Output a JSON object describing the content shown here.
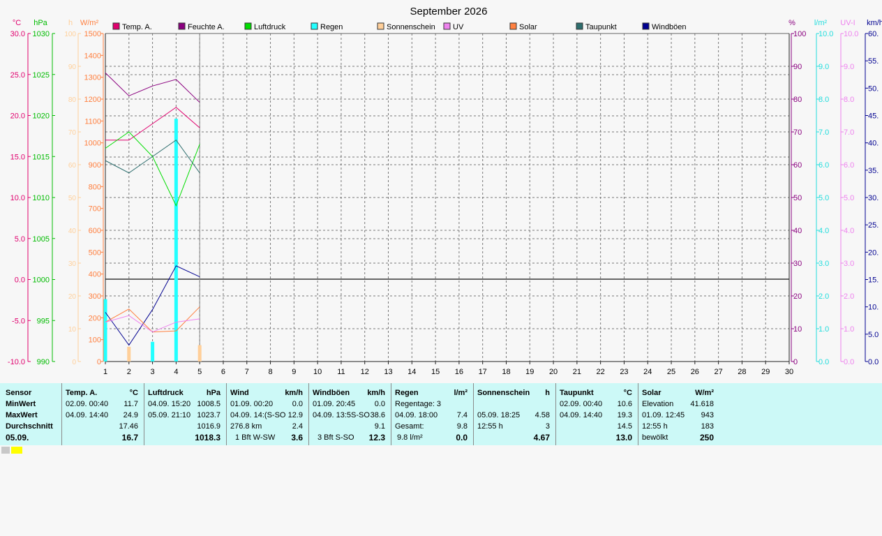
{
  "title": "September 2026",
  "legend": [
    {
      "label": "Temp. A.",
      "color": "#e0006e"
    },
    {
      "label": "Feuchte A.",
      "color": "#8a007f"
    },
    {
      "label": "Luftdruck",
      "color": "#00dd00"
    },
    {
      "label": "Regen",
      "color": "#22ffff"
    },
    {
      "label": "Sonnenschein",
      "color": "#ffcf99"
    },
    {
      "label": "UV",
      "color": "#ee82ee"
    },
    {
      "label": "Solar",
      "color": "#ff8040"
    },
    {
      "label": "Taupunkt",
      "color": "#2e6e6e"
    },
    {
      "label": "Windböen",
      "color": "#000090"
    }
  ],
  "axes": {
    "temp": {
      "unit": "°C",
      "color": "#e0006e",
      "ticks": [
        "30.0",
        "25.0",
        "20.0",
        "15.0",
        "10.0",
        "5.0",
        "0.0",
        "-5.0",
        "-10.0"
      ]
    },
    "pressure": {
      "unit": "hPa",
      "color": "#00bb00",
      "ticks": [
        "1030",
        "1025",
        "1020",
        "1015",
        "1010",
        "1005",
        "1000",
        "995",
        "990"
      ]
    },
    "sunshine": {
      "unit": "h",
      "color": "#ffcf99",
      "ticks": [
        "100",
        "90",
        "80",
        "70",
        "60",
        "50",
        "40",
        "30",
        "20",
        "10",
        "0"
      ]
    },
    "solar": {
      "unit": "W/m²",
      "color": "#ff8040",
      "ticks": [
        "1500",
        "1400",
        "1300",
        "1200",
        "1100",
        "1000",
        "900",
        "800",
        "700",
        "600",
        "500",
        "400",
        "300",
        "200",
        "100",
        "0"
      ]
    },
    "humidity": {
      "unit": "%",
      "color": "#8a007f",
      "ticks": [
        "100",
        "90",
        "80",
        "70",
        "60",
        "50",
        "40",
        "30",
        "20",
        "10",
        "0"
      ]
    },
    "rain": {
      "unit": "l/m²",
      "color": "#22dddd",
      "ticks": [
        "10.0",
        "9.0",
        "8.0",
        "7.0",
        "6.0",
        "5.0",
        "4.0",
        "3.0",
        "2.0",
        "1.0",
        "0.0"
      ]
    },
    "uv": {
      "unit": "UV-I",
      "color": "#ee82ee",
      "ticks": [
        "10.0",
        "9.0",
        "8.0",
        "7.0",
        "6.0",
        "5.0",
        "4.0",
        "3.0",
        "2.0",
        "1.0",
        "0.0"
      ]
    },
    "wind": {
      "unit": "km/h",
      "color": "#000090",
      "ticks": [
        "60.",
        "55.",
        "50.",
        "45.",
        "40.",
        "35.",
        "30.",
        "25.",
        "20.",
        "15.",
        "10.",
        "5.0",
        "0.0"
      ]
    },
    "x_ticks": [
      "1",
      "2",
      "3",
      "4",
      "5",
      "6",
      "7",
      "8",
      "9",
      "10",
      "11",
      "12",
      "13",
      "14",
      "15",
      "16",
      "17",
      "18",
      "19",
      "20",
      "21",
      "22",
      "23",
      "24",
      "25",
      "26",
      "27",
      "28",
      "29",
      "30"
    ]
  },
  "chart_data": {
    "type": "line",
    "title": "September 2026",
    "x": [
      1,
      2,
      3,
      4,
      5
    ],
    "xlim": [
      1,
      30
    ],
    "grid": true,
    "series": [
      {
        "name": "Temp. A.",
        "axis": "temp",
        "values": [
          17.0,
          17.0,
          19.0,
          21.0,
          18.5
        ]
      },
      {
        "name": "Feuchte A.",
        "axis": "humidity",
        "values": [
          88,
          81,
          84,
          86,
          79
        ]
      },
      {
        "name": "Luftdruck",
        "axis": "pressure",
        "values": [
          1016.0,
          1018.0,
          1015.0,
          1009.0,
          1016.5
        ]
      },
      {
        "name": "Taupunkt",
        "axis": "temp",
        "values": [
          14.5,
          13.0,
          15.0,
          17.0,
          13.0
        ]
      },
      {
        "name": "Windböen",
        "axis": "wind",
        "values": [
          9.0,
          3.0,
          9.5,
          17.5,
          15.5
        ]
      },
      {
        "name": "Solar",
        "axis": "solar",
        "values": [
          180,
          240,
          135,
          140,
          250
        ]
      },
      {
        "name": "UV",
        "axis": "uv",
        "values": [
          1.2,
          1.4,
          0.9,
          1.2,
          1.3
        ]
      }
    ],
    "bars": [
      {
        "name": "Regen",
        "axis": "rain",
        "values": [
          1.9,
          0.0,
          0.6,
          7.4,
          0.0
        ]
      },
      {
        "name": "Sonnenschein",
        "axis": "sunshine",
        "values": [
          0,
          4.5,
          0,
          0,
          5.0
        ]
      }
    ]
  },
  "summary": {
    "rowlabels": {
      "title": "Sensor",
      "min": "MinWert",
      "max": "MaxWert",
      "avg": "Durchschnitt",
      "date": "05.09."
    },
    "temp": {
      "title": "Temp. A.",
      "unit": "°C",
      "min_date": "02.09.  00:40",
      "min": "11.7",
      "max_date": "04.09.  14:40",
      "max": "24.9",
      "avg": "17.46",
      "current": "16.7"
    },
    "pressure": {
      "title": "Luftdruck",
      "unit": "hPa",
      "min_date": "04.09.  15:20",
      "min": "1008.5",
      "max_date": "05.09.  21:10",
      "max": "1023.7",
      "avg": "1016.9",
      "current": "1018.3"
    },
    "wind": {
      "title": "Wind",
      "unit": "km/h",
      "min_date": "01.09.  00:20",
      "min": "0.0",
      "max_date": "04.09.  14:(S-SO",
      "max": "12.9",
      "dist": "276.8 km",
      "avg": "2.4",
      "bft": "1 Bft W-SW",
      "current": "3.6"
    },
    "gusts": {
      "title": "Windböen",
      "unit": "km/h",
      "min_date": "01.09.  20:45",
      "min": "0.0",
      "max_date": "04.09.  13:5S-SO",
      "max": "38.6",
      "avg": "9.1",
      "bft": "3 Bft S-SO",
      "current": "12.3"
    },
    "rain": {
      "title": "Regen",
      "unit": "l/m²",
      "days": "Regentage: 3",
      "max_date": "04.09.  18:00",
      "max": "7.4",
      "total_label": "Gesamt:",
      "total": "9.8",
      "today": "9.8 l/m²",
      "current": "0.0"
    },
    "sunshine": {
      "title": "Sonnenschein",
      "unit": "h",
      "max_date": "05.09.  18:25",
      "max": "4.58",
      "daylen": "12:55 h",
      "avg": "3",
      "current": "4.67"
    },
    "dewpoint": {
      "title": "Taupunkt",
      "unit": "°C",
      "min_date": "02.09.  00:40",
      "min": "10.6",
      "max_date": "04.09.  14:40",
      "max": "19.3",
      "avg": "14.5",
      "current": "13.0"
    },
    "solar": {
      "title": "Solar",
      "unit": "W/m²",
      "elev_label": "Elevation",
      "elev": "41.618",
      "max_date": "01.09.  12:45",
      "max": "943",
      "daylen": "12:55 h",
      "avg": "183",
      "sky": "bewölkt",
      "current": "250"
    }
  }
}
